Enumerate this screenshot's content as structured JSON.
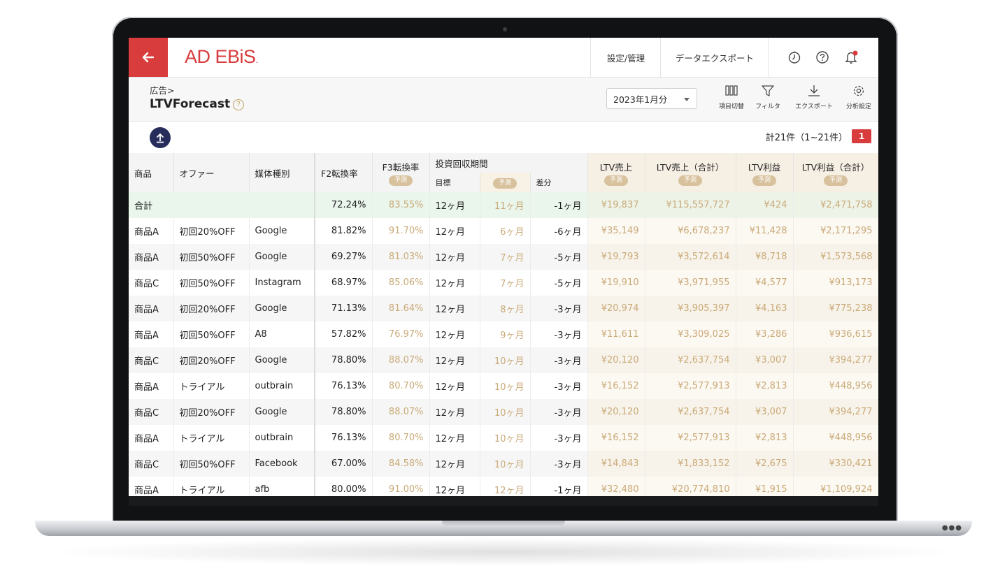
{
  "header": {
    "logo_text": "AD EBiS",
    "logo_dot": ".",
    "nav_settings": "設定/管理",
    "nav_export": "データエクスポート",
    "accent_color": "#d83c3c"
  },
  "subheader": {
    "breadcrumb": "広告>",
    "page_title": "LTVForecast",
    "help_mark": "?",
    "period_value": "2023年1月分",
    "tools": {
      "columns": "項目切替",
      "filter": "フィルタ",
      "export": "エクスポート",
      "analysis": "分析設定"
    }
  },
  "list": {
    "count_text": "計21件（1~21件）",
    "page": "1"
  },
  "table": {
    "headers": {
      "product": "商品",
      "offer": "オファー",
      "media": "媒体種別",
      "f2": "F2転換率",
      "f3": "F3転換率",
      "payback": "投資回収期間",
      "target": "目標",
      "diff": "差分",
      "ltv_sales": "LTV売上",
      "ltv_sales_total": "LTV売上（合計）",
      "ltv_profit": "LTV利益",
      "ltv_profit_total": "LTV利益（合計）",
      "pred": "予測"
    },
    "total": {
      "label": "合計",
      "f2": "72.24%",
      "f3": "83.55%",
      "target": "12ヶ月",
      "pred": "11ヶ月",
      "diff": "-1ヶ月",
      "ltv_sales": "¥19,837",
      "ltv_sales_total": "¥115,557,727",
      "ltv_profit": "¥424",
      "ltv_profit_total": "¥2,471,758"
    },
    "rows": [
      {
        "product": "商品A",
        "offer": "初回20%OFF",
        "media": "Google",
        "f2": "81.82%",
        "f3": "91.70%",
        "target": "12ヶ月",
        "pred": "6ヶ月",
        "diff": "-6ヶ月",
        "ltv_sales": "¥35,149",
        "ltv_sales_total": "¥6,678,237",
        "ltv_profit": "¥11,428",
        "ltv_profit_total": "¥2,171,295"
      },
      {
        "product": "商品A",
        "offer": "初回50%OFF",
        "media": "Google",
        "f2": "69.27%",
        "f3": "81.03%",
        "target": "12ヶ月",
        "pred": "7ヶ月",
        "diff": "-5ヶ月",
        "ltv_sales": "¥19,793",
        "ltv_sales_total": "¥3,572,614",
        "ltv_profit": "¥8,718",
        "ltv_profit_total": "¥1,573,568"
      },
      {
        "product": "商品C",
        "offer": "初回50%OFF",
        "media": "Instagram",
        "f2": "68.97%",
        "f3": "85.06%",
        "target": "12ヶ月",
        "pred": "7ヶ月",
        "diff": "-5ヶ月",
        "ltv_sales": "¥19,910",
        "ltv_sales_total": "¥3,971,955",
        "ltv_profit": "¥4,577",
        "ltv_profit_total": "¥913,173"
      },
      {
        "product": "商品A",
        "offer": "初回20%OFF",
        "media": "Google",
        "f2": "71.13%",
        "f3": "81.64%",
        "target": "12ヶ月",
        "pred": "8ヶ月",
        "diff": "-3ヶ月",
        "ltv_sales": "¥20,974",
        "ltv_sales_total": "¥3,905,397",
        "ltv_profit": "¥4,163",
        "ltv_profit_total": "¥775,238"
      },
      {
        "product": "商品A",
        "offer": "初回50%OFF",
        "media": "A8",
        "f2": "57.82%",
        "f3": "76.97%",
        "target": "12ヶ月",
        "pred": "9ヶ月",
        "diff": "-3ヶ月",
        "ltv_sales": "¥11,611",
        "ltv_sales_total": "¥3,309,025",
        "ltv_profit": "¥3,286",
        "ltv_profit_total": "¥936,615"
      },
      {
        "product": "商品C",
        "offer": "初回20%OFF",
        "media": "Google",
        "f2": "78.80%",
        "f3": "88.07%",
        "target": "12ヶ月",
        "pred": "10ヶ月",
        "diff": "-3ヶ月",
        "ltv_sales": "¥20,120",
        "ltv_sales_total": "¥2,637,754",
        "ltv_profit": "¥3,007",
        "ltv_profit_total": "¥394,277"
      },
      {
        "product": "商品A",
        "offer": "トライアル",
        "media": "outbrain",
        "f2": "76.13%",
        "f3": "80.70%",
        "target": "12ヶ月",
        "pred": "10ヶ月",
        "diff": "-3ヶ月",
        "ltv_sales": "¥16,152",
        "ltv_sales_total": "¥2,577,913",
        "ltv_profit": "¥2,813",
        "ltv_profit_total": "¥448,956"
      },
      {
        "product": "商品C",
        "offer": "初回20%OFF",
        "media": "Google",
        "f2": "78.80%",
        "f3": "88.07%",
        "target": "12ヶ月",
        "pred": "10ヶ月",
        "diff": "-3ヶ月",
        "ltv_sales": "¥20,120",
        "ltv_sales_total": "¥2,637,754",
        "ltv_profit": "¥3,007",
        "ltv_profit_total": "¥394,277"
      },
      {
        "product": "商品A",
        "offer": "トライアル",
        "media": "outbrain",
        "f2": "76.13%",
        "f3": "80.70%",
        "target": "12ヶ月",
        "pred": "10ヶ月",
        "diff": "-3ヶ月",
        "ltv_sales": "¥16,152",
        "ltv_sales_total": "¥2,577,913",
        "ltv_profit": "¥2,813",
        "ltv_profit_total": "¥448,956"
      },
      {
        "product": "商品C",
        "offer": "初回50%OFF",
        "media": "Facebook",
        "f2": "67.00%",
        "f3": "84.58%",
        "target": "12ヶ月",
        "pred": "10ヶ月",
        "diff": "-3ヶ月",
        "ltv_sales": "¥14,843",
        "ltv_sales_total": "¥1,833,152",
        "ltv_profit": "¥2,675",
        "ltv_profit_total": "¥330,421"
      },
      {
        "product": "商品A",
        "offer": "トライアル",
        "media": "afb",
        "f2": "80.00%",
        "f3": "91.00%",
        "target": "12ヶ月",
        "pred": "12ヶ月",
        "diff": "-1ヶ月",
        "ltv_sales": "¥32,480",
        "ltv_sales_total": "¥20,774,810",
        "ltv_profit": "¥1,915",
        "ltv_profit_total": "¥1,109,924"
      }
    ]
  }
}
